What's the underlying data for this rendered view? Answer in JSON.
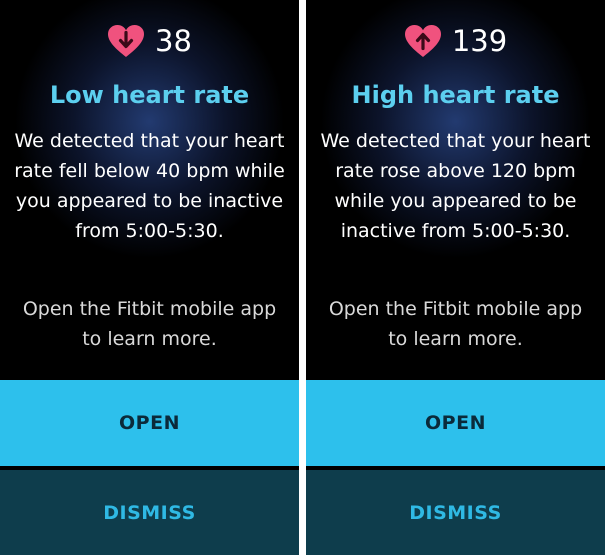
{
  "colors": {
    "accent_text": "#5ccfef",
    "heart": "#f0527e",
    "open_bg": "#2dc0ec",
    "open_text": "#0b2a3a",
    "dismiss_bg": "#0e3d4c",
    "dismiss_text": "#2fb9e4"
  },
  "screens": [
    {
      "heart_icon": "heart-arrow-down-icon",
      "heart_rate": "38",
      "title": "Low heart rate",
      "message": "We detected that your heart rate fell below 40 bpm while you appeared to be inactive from 5:00-5:30.",
      "hint": "Open the Fitbit mobile app to learn more.",
      "open_label": "OPEN",
      "dismiss_label": "DISMISS"
    },
    {
      "heart_icon": "heart-arrow-up-icon",
      "heart_rate": "139",
      "title": "High heart rate",
      "message": "We detected that your heart rate rose above 120 bpm while you appeared to be inactive from 5:00-5:30.",
      "hint": "Open the Fitbit mobile app to learn more.",
      "open_label": "OPEN",
      "dismiss_label": "DISMISS"
    }
  ]
}
